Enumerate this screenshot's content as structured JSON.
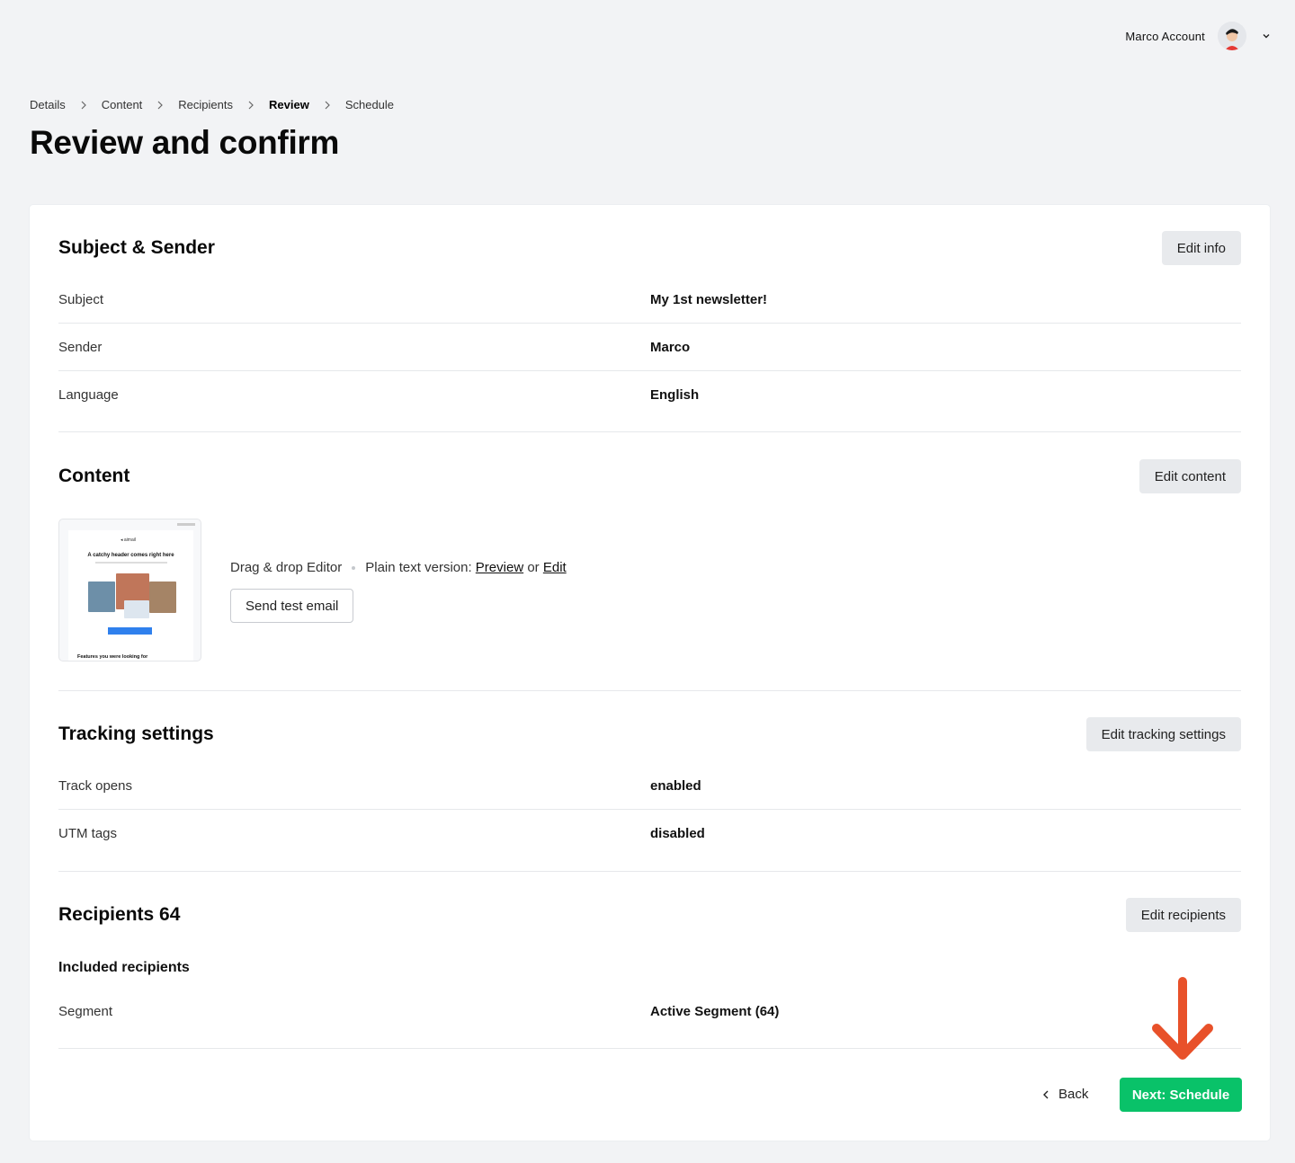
{
  "account": {
    "name": "Marco Account",
    "avatar_icon": "user-avatar-icon",
    "menu_icon": "chevron-down-icon"
  },
  "breadcrumb": {
    "items": [
      "Details",
      "Content",
      "Recipients",
      "Review",
      "Schedule"
    ],
    "active_index": 3
  },
  "page_title": "Review and confirm",
  "subject_sender": {
    "title": "Subject & Sender",
    "edit_label": "Edit info",
    "rows": [
      {
        "label": "Subject",
        "value": "My 1st newsletter!"
      },
      {
        "label": "Sender",
        "value": "Marco"
      },
      {
        "label": "Language",
        "value": "English"
      }
    ]
  },
  "content": {
    "title": "Content",
    "edit_label": "Edit content",
    "editor_type": "Drag & drop Editor",
    "plain_text_label": "Plain text version:",
    "preview_link": "Preview",
    "or_text": "or",
    "edit_link": "Edit",
    "send_test_label": "Send test email",
    "thumbnail": {
      "logo": "◂ aimail",
      "header": "A catchy header comes right here",
      "footer": "Features you were looking for"
    }
  },
  "tracking": {
    "title": "Tracking settings",
    "edit_label": "Edit tracking settings",
    "rows": [
      {
        "label": "Track opens",
        "value": "enabled"
      },
      {
        "label": "UTM tags",
        "value": "disabled"
      }
    ]
  },
  "recipients": {
    "title": "Recipients 64",
    "edit_label": "Edit recipients",
    "included_title": "Included recipients",
    "rows": [
      {
        "label": "Segment",
        "value": "Active Segment (64)"
      }
    ]
  },
  "footer": {
    "back_label": "Back",
    "next_label": "Next: Schedule"
  },
  "colors": {
    "primary_green": "#09c269",
    "annotation_arrow": "#e8512a",
    "background": "#f2f3f5"
  }
}
